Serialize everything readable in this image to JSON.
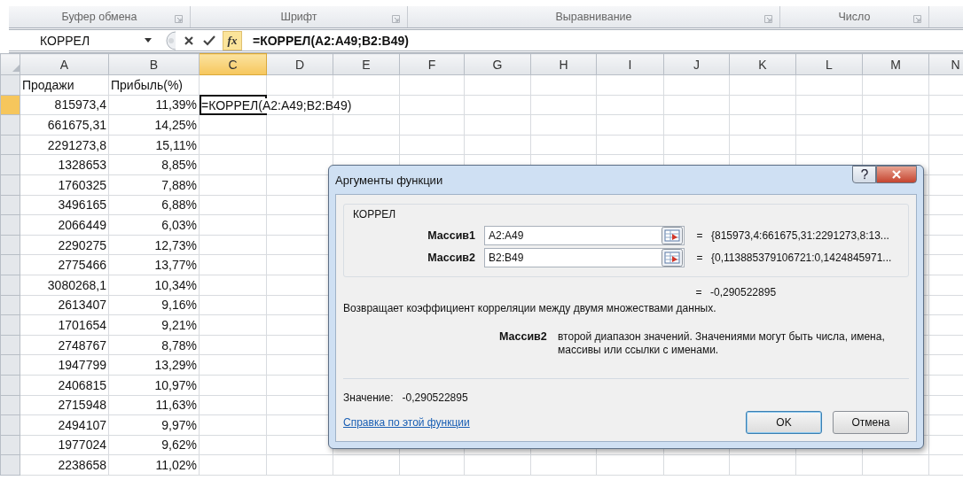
{
  "ribbon_groups": [
    {
      "label": "Буфер обмена"
    },
    {
      "label": "Шрифт"
    },
    {
      "label": "Выравнивание"
    },
    {
      "label": "Число"
    }
  ],
  "formula_bar": {
    "name_box": "КОРРЕЛ",
    "insert_function": "fx",
    "formula": "=КОРРЕЛ(A2:A49;B2:B49)"
  },
  "columns": [
    {
      "label": "A",
      "selected": false
    },
    {
      "label": "B",
      "selected": false
    },
    {
      "label": "C",
      "selected": true
    },
    {
      "label": "D",
      "selected": false
    },
    {
      "label": "E",
      "selected": false
    },
    {
      "label": "F",
      "selected": false
    },
    {
      "label": "G",
      "selected": false
    },
    {
      "label": "H",
      "selected": false
    },
    {
      "label": "I",
      "selected": false
    },
    {
      "label": "J",
      "selected": false
    },
    {
      "label": "K",
      "selected": false
    },
    {
      "label": "L",
      "selected": false
    },
    {
      "label": "M",
      "selected": false
    },
    {
      "label": "N",
      "selected": false
    }
  ],
  "rows": [
    {
      "selected": false,
      "cells": [
        "Продажи",
        "Прибыль(%)"
      ]
    },
    {
      "selected": true,
      "cells": [
        "815973,4",
        "11,39%",
        "=КОРРЕЛ(A2:A49;B2:B49)"
      ]
    },
    {
      "selected": false,
      "cells": [
        "661675,31",
        "14,25%"
      ]
    },
    {
      "selected": false,
      "cells": [
        "2291273,8",
        "15,11%"
      ]
    },
    {
      "selected": false,
      "cells": [
        "1328653",
        "8,85%"
      ]
    },
    {
      "selected": false,
      "cells": [
        "1760325",
        "7,88%"
      ]
    },
    {
      "selected": false,
      "cells": [
        "3496165",
        "6,88%"
      ]
    },
    {
      "selected": false,
      "cells": [
        "2066449",
        "6,03%"
      ]
    },
    {
      "selected": false,
      "cells": [
        "2290275",
        "12,73%"
      ]
    },
    {
      "selected": false,
      "cells": [
        "2775466",
        "13,77%"
      ]
    },
    {
      "selected": false,
      "cells": [
        "3080268,1",
        "10,34%"
      ]
    },
    {
      "selected": false,
      "cells": [
        "2613407",
        "9,16%"
      ]
    },
    {
      "selected": false,
      "cells": [
        "1701654",
        "9,21%"
      ]
    },
    {
      "selected": false,
      "cells": [
        "2748767",
        "8,78%"
      ]
    },
    {
      "selected": false,
      "cells": [
        "1947799",
        "13,29%"
      ]
    },
    {
      "selected": false,
      "cells": [
        "2406815",
        "10,97%"
      ]
    },
    {
      "selected": false,
      "cells": [
        "2715948",
        "11,63%"
      ]
    },
    {
      "selected": false,
      "cells": [
        "2494107",
        "9,97%"
      ]
    },
    {
      "selected": false,
      "cells": [
        "1977024",
        "9,62%"
      ]
    },
    {
      "selected": false,
      "cells": [
        "2238658",
        "11,02%"
      ]
    }
  ],
  "dialog": {
    "title": "Аргументы функции",
    "function_name": "КОРРЕЛ",
    "arguments": [
      {
        "name": "Массив1",
        "value": "A2:A49",
        "equals": "=",
        "result": "{815973,4:661675,31:2291273,8:13..."
      },
      {
        "name": "Массив2",
        "value": "B2:B49",
        "equals": "=",
        "result": "{0,113885379106721:0,1424845971..."
      }
    ],
    "result_equals": "=",
    "result": "-0,290522895",
    "description": "Возвращает коэффициент корреляции между двумя множествами данных.",
    "argument_help": {
      "name": "Массив2",
      "text": "второй диапазон значений. Значениями могут быть числа, имена, массивы или ссылки с именами."
    },
    "value_label": "Значение:",
    "value": "-0,290522895",
    "help_link": "Справка по этой функции",
    "buttons": [
      {
        "label": "OK",
        "default": true
      },
      {
        "label": "Отмена",
        "default": false
      }
    ]
  }
}
